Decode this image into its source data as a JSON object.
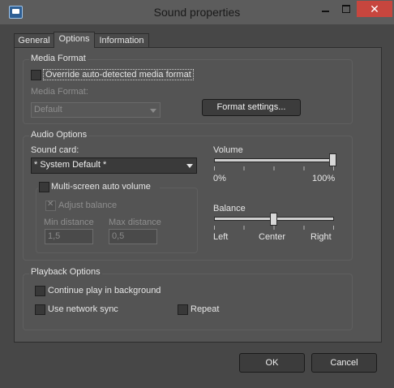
{
  "window": {
    "title": "Sound properties",
    "close_glyph": "✕"
  },
  "tabs": [
    {
      "label": "General"
    },
    {
      "label": "Options"
    },
    {
      "label": "Information"
    }
  ],
  "media_format": {
    "legend": "Media Format",
    "override_label": "Override auto-detected media format",
    "override_checked": false,
    "format_label": "Media Format:",
    "format_value": "Default",
    "settings_button": "Format settings..."
  },
  "audio": {
    "legend": "Audio Options",
    "sound_card_label": "Sound card:",
    "sound_card_value": "* System Default *",
    "multiscreen_label": "Multi-screen auto volume",
    "multiscreen_checked": false,
    "adjust_balance_label": "Adjust balance",
    "adjust_balance_checked": true,
    "min_distance_label": "Min distance",
    "min_distance_value": "1,5",
    "max_distance_label": "Max distance",
    "max_distance_value": "0,5",
    "volume_label": "Volume",
    "volume_min": "0%",
    "volume_max": "100%",
    "volume_level": 1.0,
    "balance_label": "Balance",
    "balance_left": "Left",
    "balance_center": "Center",
    "balance_right": "Right",
    "balance_level": 0.5
  },
  "playback": {
    "legend": "Playback Options",
    "continue_label": "Continue play in background",
    "network_sync_label": "Use network sync",
    "repeat_label": "Repeat"
  },
  "footer": {
    "ok": "OK",
    "cancel": "Cancel"
  },
  "colors": {
    "close_button": "#c7463e",
    "background": "#474747",
    "panel": "#545454"
  }
}
